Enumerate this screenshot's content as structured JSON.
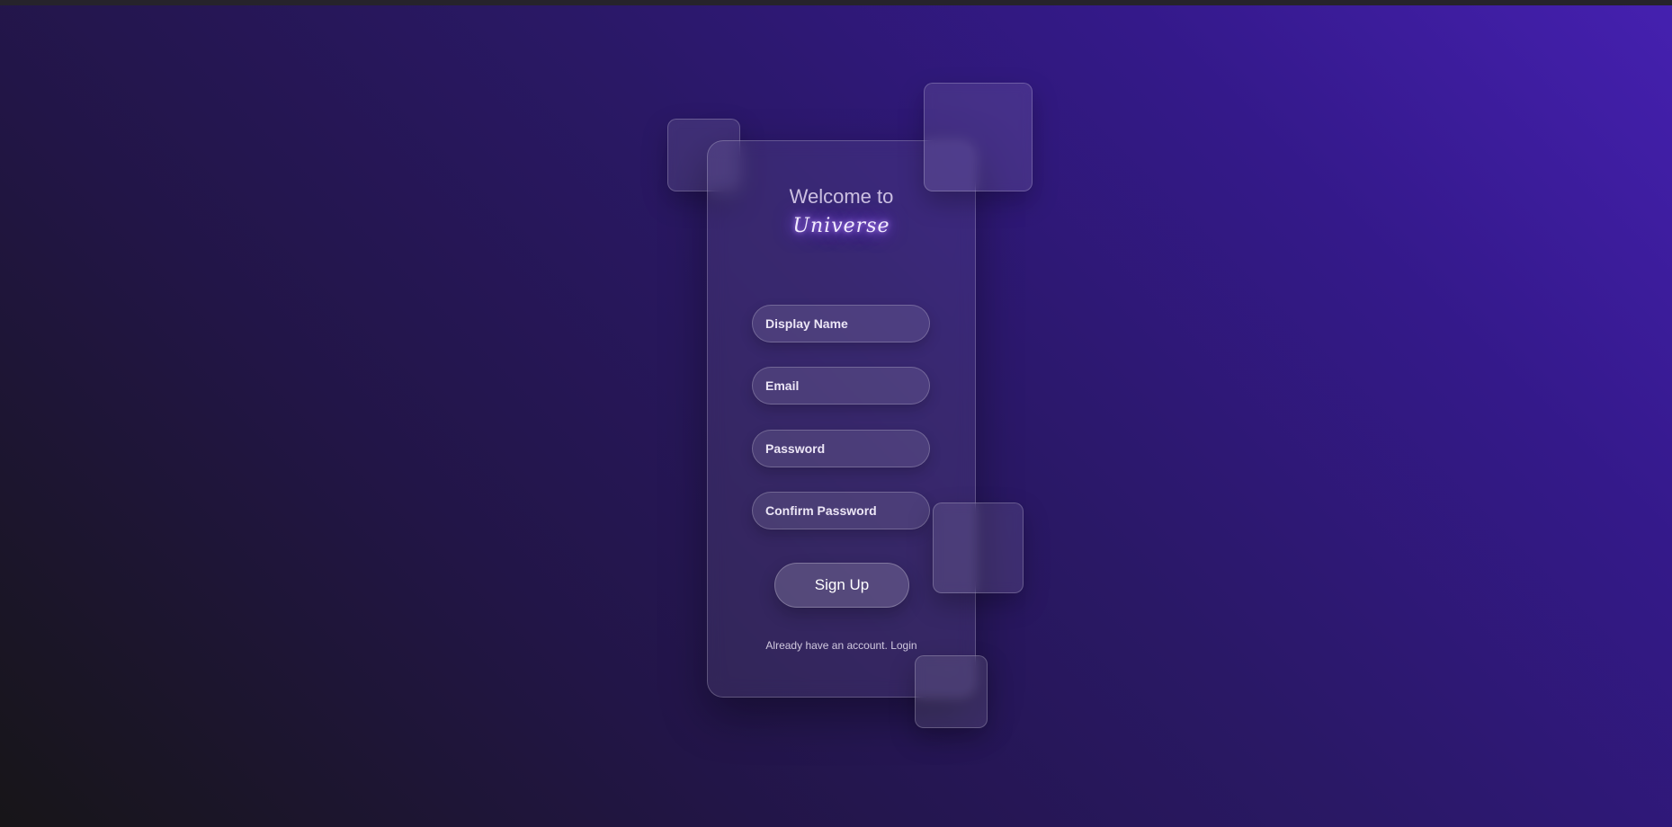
{
  "form": {
    "welcome": "Welcome to",
    "brand": "Universe",
    "fields": [
      {
        "placeholder": "Display Name"
      },
      {
        "placeholder": "Email"
      },
      {
        "placeholder": "Password"
      },
      {
        "placeholder": "Confirm Password"
      }
    ],
    "submit_label": "Sign Up",
    "footer_text": "Already have an account.",
    "login_label": "Login"
  },
  "colors": {
    "accent_glow": "#8e5cff",
    "background_top_right": "#4520b0",
    "background_bottom_left": "#171518"
  }
}
